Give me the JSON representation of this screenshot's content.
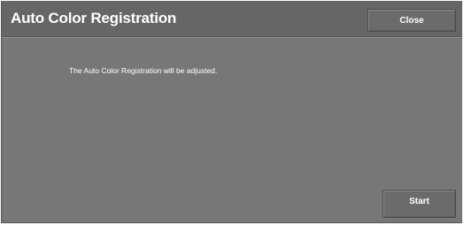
{
  "dialog": {
    "title": "Auto Color Registration",
    "close_label": "Close",
    "message": "The Auto Color Registration will be adjusted.",
    "start_label": "Start"
  },
  "colors": {
    "panel_background": "#777777",
    "title_bar_background": "#666666",
    "button_background": "#6b6b6b",
    "text": "#ffffff"
  }
}
